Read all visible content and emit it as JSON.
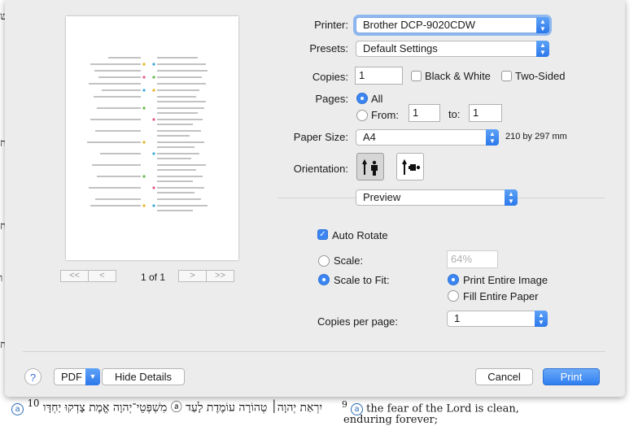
{
  "preview": {
    "page_counter": "1 of 1",
    "first_label": "<<",
    "prev_label": "<",
    "next_label": ">",
    "last_label": ">>"
  },
  "printer": {
    "label": "Printer:",
    "value": "Brother DCP-9020CDW"
  },
  "presets": {
    "label": "Presets:",
    "value": "Default Settings"
  },
  "copies": {
    "label": "Copies:",
    "value": "1",
    "black_white": "Black & White",
    "two_sided": "Two-Sided"
  },
  "pages": {
    "label": "Pages:",
    "all": "All",
    "from": "From:",
    "from_value": "1",
    "to": "to:",
    "to_value": "1"
  },
  "paper_size": {
    "label": "Paper Size:",
    "value": "A4",
    "dimensions": "210 by 297 mm"
  },
  "orientation": {
    "label": "Orientation:"
  },
  "section": {
    "value": "Preview"
  },
  "auto_rotate": {
    "label": "Auto Rotate",
    "checked": true
  },
  "scale": {
    "label": "Scale:",
    "value": "64%"
  },
  "scale_to_fit": {
    "label": "Scale to Fit:",
    "print_entire_image": "Print Entire Image",
    "fill_entire_paper": "Fill Entire Paper"
  },
  "copies_per_page": {
    "label": "Copies per page:",
    "value": "1"
  },
  "footer": {
    "help": "?",
    "pdf": "PDF",
    "hide_details": "Hide Details",
    "cancel": "Cancel",
    "print": "Print"
  },
  "background": {
    "hebrew_line": "יִרְאַת יְהוָה׀ טְהוֹרָה עוֹמֶדֶת לָעַד ⓐ מִשְׁפְּטֵי־יְהוָה אֱמֶת צָדְקוּ יַחְדָּו",
    "verse_a": "a",
    "verse_10": "10",
    "verse_9": "9",
    "english_1": "the fear of the Lord is clean,",
    "english_2": "enduring forever;",
    "margin_chars": [
      "ש",
      "ח",
      "ח",
      "ו",
      "ח"
    ]
  },
  "colors": {
    "accent": "#2f7ff0",
    "focus_ring": "#8fb8ef",
    "sheet": "#ececec"
  }
}
